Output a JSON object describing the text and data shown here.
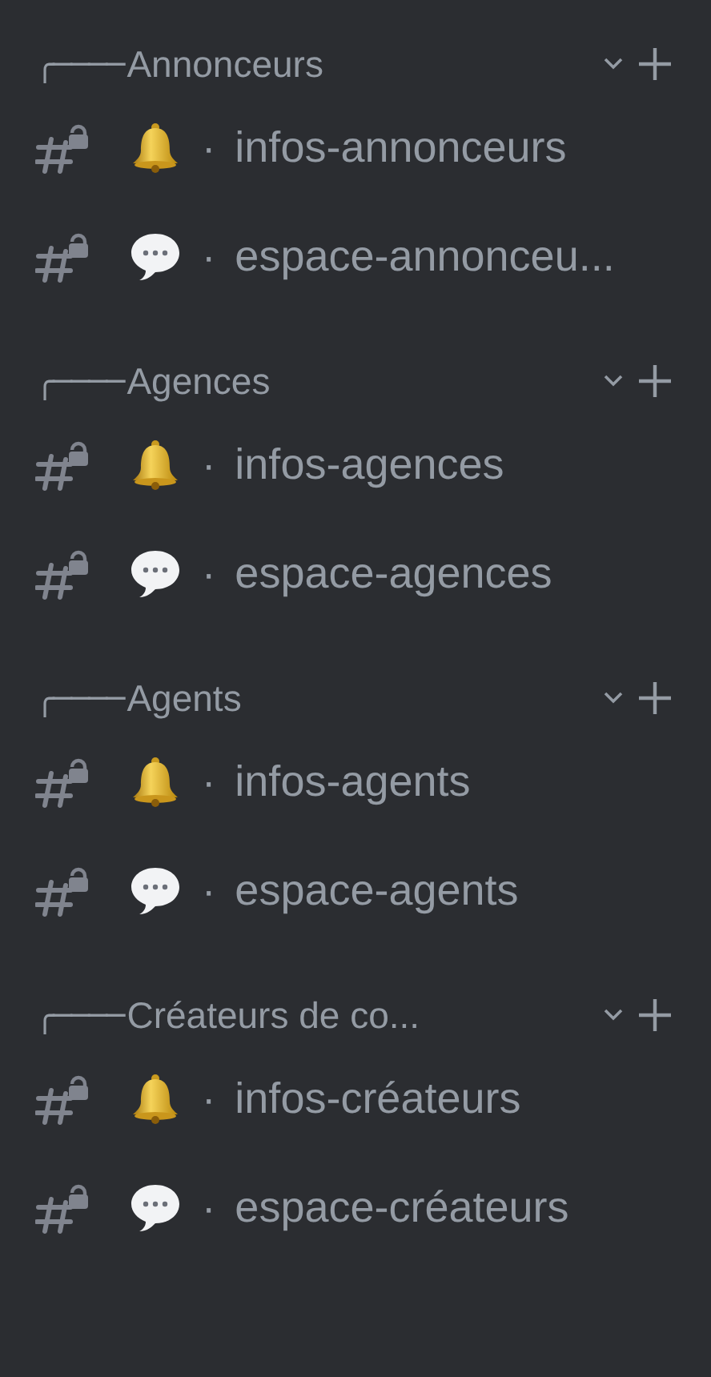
{
  "categories": [
    {
      "prefix": "╭────",
      "name": "Annonceurs",
      "channels": [
        {
          "kind": "bell",
          "separator": "·",
          "name": "infos-annonceurs"
        },
        {
          "kind": "speech",
          "separator": "·",
          "name": "espace-annonceu..."
        }
      ]
    },
    {
      "prefix": "╭────",
      "name": "Agences",
      "channels": [
        {
          "kind": "bell",
          "separator": "·",
          "name": "infos-agences"
        },
        {
          "kind": "speech",
          "separator": "·",
          "name": "espace-agences"
        }
      ]
    },
    {
      "prefix": "╭────",
      "name": "Agents",
      "channels": [
        {
          "kind": "bell",
          "separator": "·",
          "name": "infos-agents"
        },
        {
          "kind": "speech",
          "separator": "·",
          "name": "espace-agents"
        }
      ]
    },
    {
      "prefix": "╭────",
      "name": "Créateurs de co...",
      "channels": [
        {
          "kind": "bell",
          "separator": "·",
          "name": "infos-créateurs"
        },
        {
          "kind": "speech",
          "separator": "·",
          "name": "espace-créateurs"
        }
      ]
    }
  ]
}
